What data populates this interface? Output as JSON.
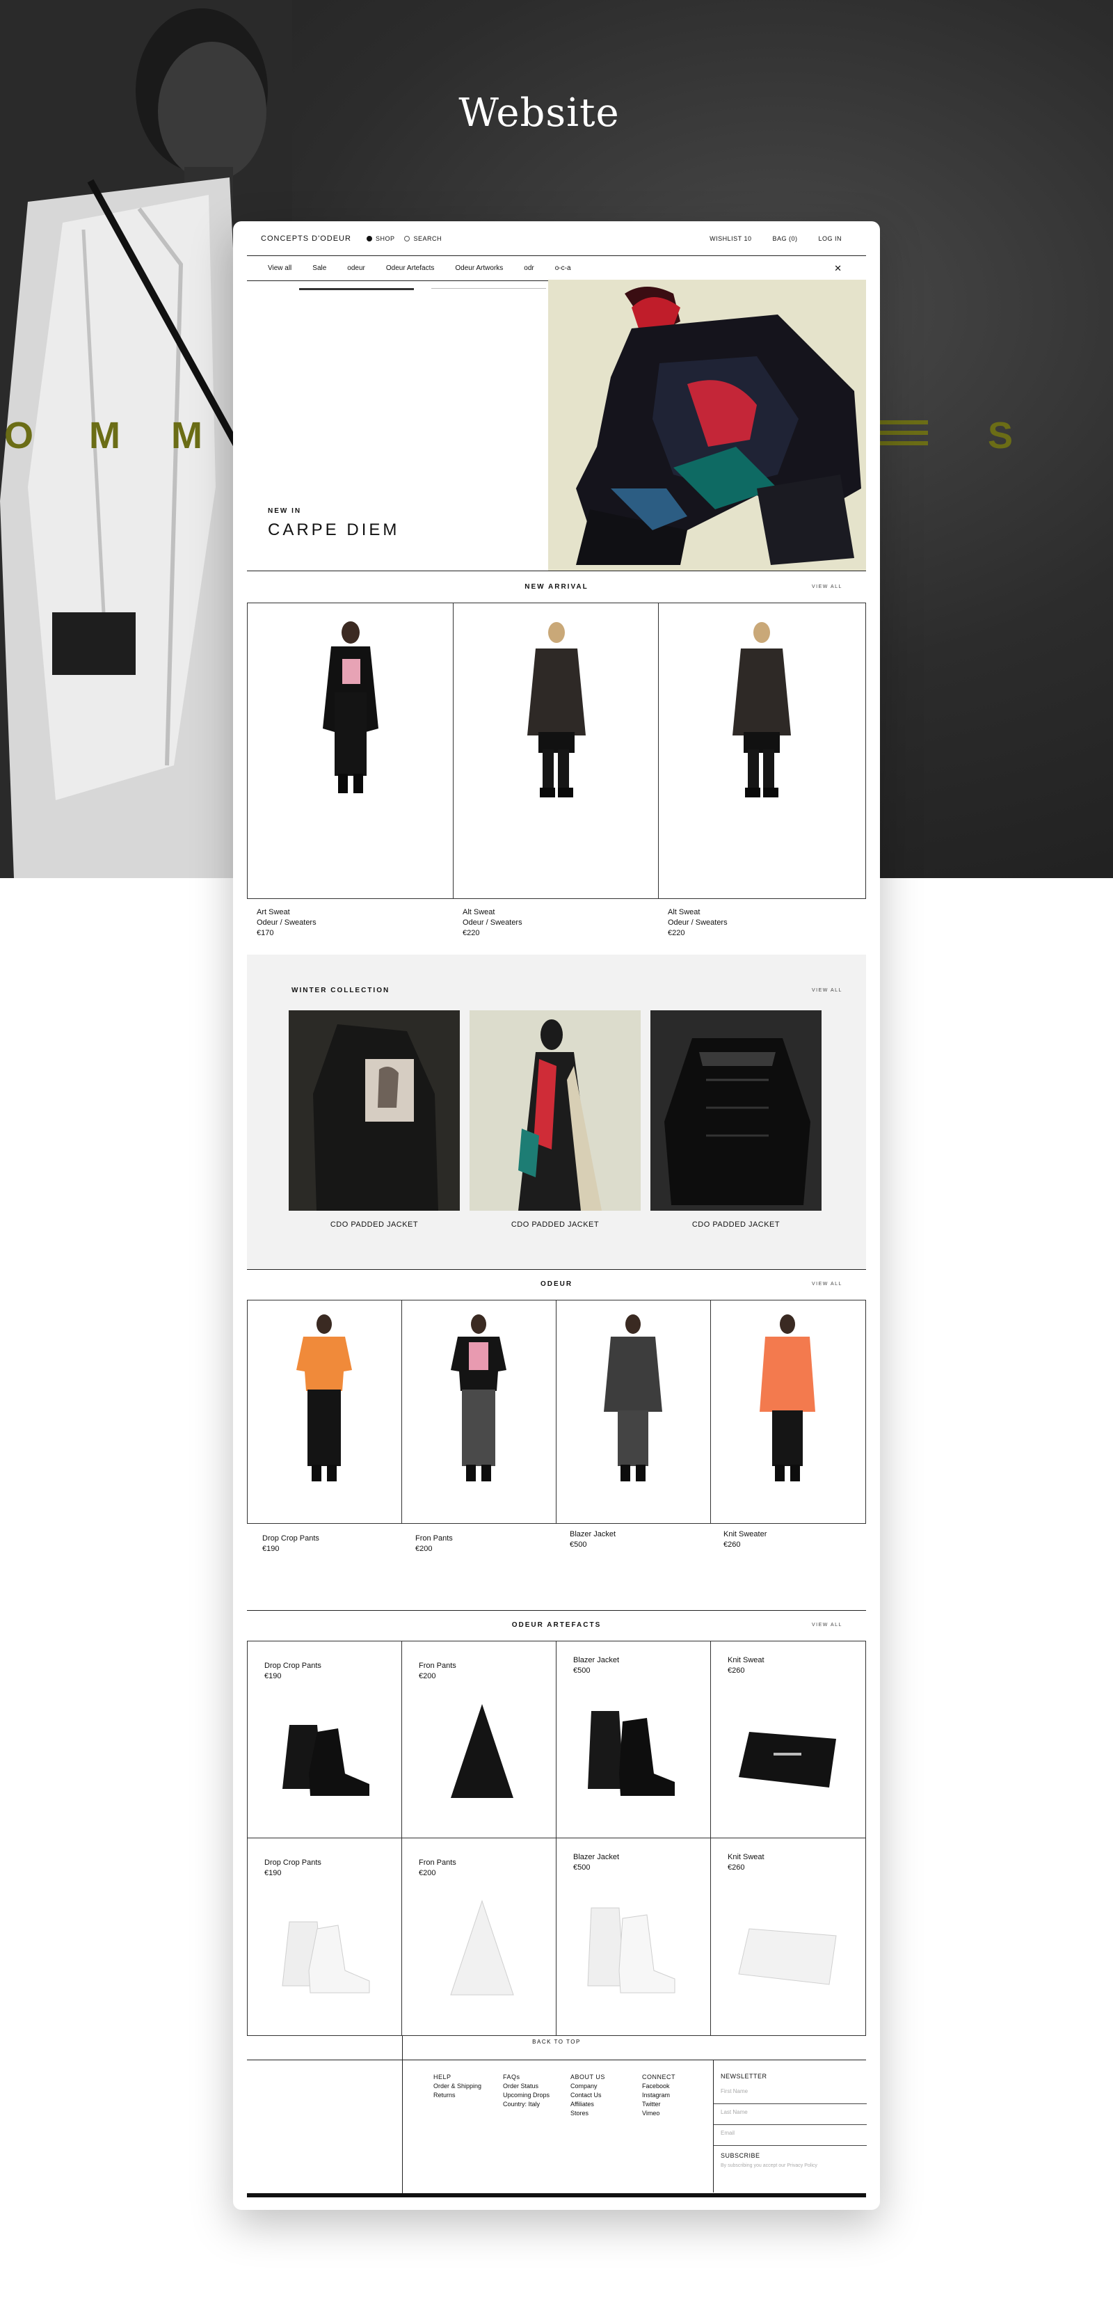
{
  "page_title": "Website",
  "hero_letters": [
    "O",
    "M",
    "M",
    "S"
  ],
  "header": {
    "logo": "CONCEPTS D'ODEUR",
    "mode_options": [
      {
        "label": "SHOP",
        "selected": true
      },
      {
        "label": "SEARCH",
        "selected": false
      }
    ],
    "wishlist": "WISHLIST 10",
    "bag": "BAG (0)",
    "login": "LOG IN"
  },
  "subnav": {
    "items": [
      "View all",
      "Sale",
      "odeur",
      "Odeur Artefacts",
      "Odeur Artworks",
      "odr",
      "o-c-a"
    ],
    "close_icon": "close-icon"
  },
  "banner": {
    "kicker": "NEW IN",
    "title": "CARPE DIEM"
  },
  "new_arrival": {
    "title": "NEW ARRIVAL",
    "view_all": "VIEW ALL",
    "products": [
      {
        "name": "Art Sweat",
        "category": "Odeur / Sweaters",
        "price": "€170"
      },
      {
        "name": "Alt Sweat",
        "category": "Odeur / Sweaters",
        "price": "€220"
      },
      {
        "name": "Alt Sweat",
        "category": "Odeur / Sweaters",
        "price": "€220"
      }
    ]
  },
  "winter": {
    "title": "WINTER COLLECTION",
    "view_all": "VIEW ALL",
    "items": [
      "CDO PADDED JACKET",
      "CDO PADDED JACKET",
      "CDO PADDED JACKET"
    ]
  },
  "odeur": {
    "title": "ODEUR",
    "view_all": "VIEW ALL",
    "products": [
      {
        "name": "Drop Crop Pants",
        "price": "€190"
      },
      {
        "name": "Fron Pants",
        "price": "€200"
      },
      {
        "name": "Blazer Jacket",
        "price": "€500"
      },
      {
        "name": "Knit Sweater",
        "price": "€260"
      }
    ]
  },
  "artefacts": {
    "title": "ODEUR ARTEFACTS",
    "view_all": "VIEW ALL",
    "products": [
      {
        "name": "Drop Crop Pants",
        "price": "€190"
      },
      {
        "name": "Fron Pants",
        "price": "€200"
      },
      {
        "name": "Blazer Jacket",
        "price": "€500"
      },
      {
        "name": "Knit Sweat",
        "price": "€260"
      },
      {
        "name": "Drop Crop Pants",
        "price": "€190"
      },
      {
        "name": "Fron Pants",
        "price": "€200"
      },
      {
        "name": "Blazer Jacket",
        "price": "€500"
      },
      {
        "name": "Knit Sweat",
        "price": "€260"
      }
    ]
  },
  "back_to_top": "BACK TO TOP",
  "footer": {
    "help": {
      "title": "HELP",
      "links": [
        "Order & Shipping",
        "Returns"
      ]
    },
    "faqs": {
      "title": "FAQs",
      "links": [
        "Order Status",
        "Upcoming Drops",
        "Country: Italy"
      ]
    },
    "about": {
      "title": "ABOUT US",
      "links": [
        "Company",
        "Contact Us",
        "Affiliates",
        "Stores"
      ]
    },
    "connect": {
      "title": "CONNECT",
      "links": [
        "Facebook",
        "Instagram",
        "Twitter",
        "Vimeo"
      ]
    },
    "newsletter": {
      "title": "NEWSLETTER",
      "placeholders": [
        "First Name",
        "Last Name",
        "Email"
      ],
      "subscribe": "SUBSCRIBE",
      "note": "By subscribing you accept our Privacy Policy"
    }
  },
  "colors": {
    "hero_bg": "#2c2c2c",
    "accent_olive": "#6b6d16",
    "panel_grey": "#f2f2f2"
  }
}
